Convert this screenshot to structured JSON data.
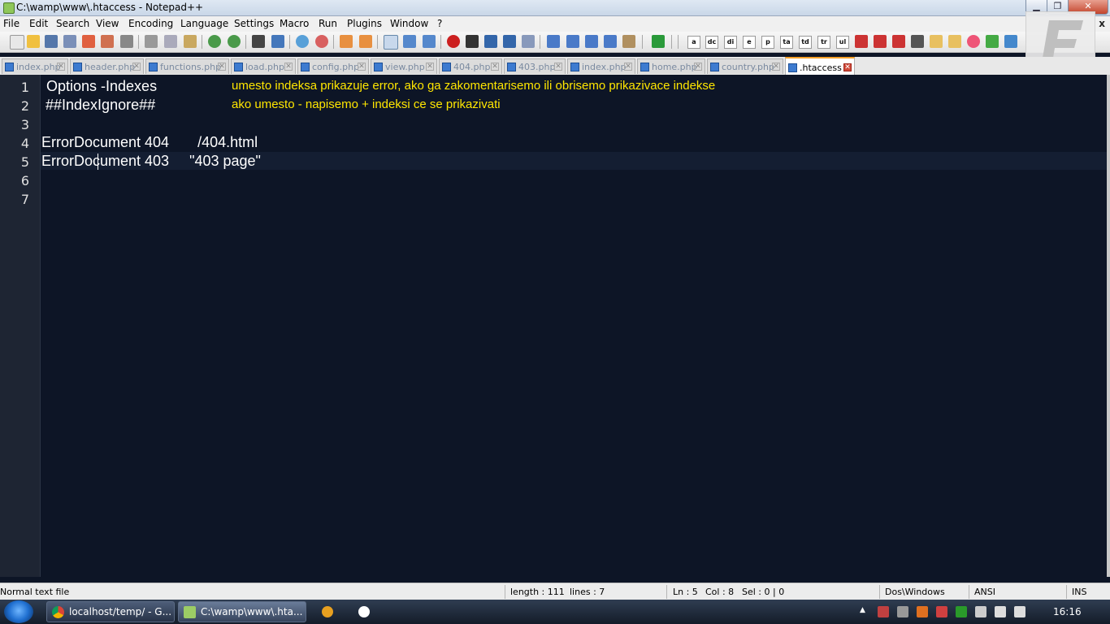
{
  "window": {
    "title": "C:\\wamp\\www\\.htaccess - Notepad++",
    "menu_close": "x"
  },
  "menu": [
    "File",
    "Edit",
    "Search",
    "View",
    "Encoding",
    "Language",
    "Settings",
    "Macro",
    "Run",
    "Plugins",
    "Window",
    "?"
  ],
  "toolbar": {
    "text_buttons": [
      "a",
      "dc",
      "di",
      "e",
      "p",
      "ta",
      "td",
      "tr",
      "ul"
    ]
  },
  "tabs": [
    {
      "label": "index.php",
      "active": false
    },
    {
      "label": "header.php",
      "active": false
    },
    {
      "label": "functions.php",
      "active": false
    },
    {
      "label": "load.php",
      "active": false
    },
    {
      "label": "config.php",
      "active": false
    },
    {
      "label": "view.php",
      "active": false
    },
    {
      "label": "404.php",
      "active": false
    },
    {
      "label": "403.php",
      "active": false
    },
    {
      "label": "index.php",
      "active": false
    },
    {
      "label": "home.php",
      "active": false
    },
    {
      "label": "country.php",
      "active": false
    },
    {
      "label": ".htaccess",
      "active": true
    }
  ],
  "editor": {
    "line_numbers": [
      "1",
      "2",
      "3",
      "4",
      "5",
      "6",
      "7"
    ],
    "lines": {
      "l1": "Options -Indexes",
      "l2": "##IndexIgnore##",
      "l4": "ErrorDocument 404       /404.html",
      "l5": "ErrorDocument 403     \"403 page\""
    },
    "comments": {
      "c1": "umesto indeksa prikazuje error, ako ga zakomentarisemo ili obrisemo prikazivace indekse",
      "c2": "ako umesto - napisemo + indeksi ce se prikazivati"
    },
    "colors": {
      "background": "#0d1526",
      "text": "#ffffff",
      "comment": "#ffe600"
    }
  },
  "status": {
    "file_type": "Normal text file",
    "length": "length : 111",
    "lines": "lines : 7",
    "ln": "Ln : 5",
    "col": "Col : 8",
    "sel": "Sel : 0 | 0",
    "eol": "Dos\\Windows",
    "encoding": "ANSI",
    "mode": "INS"
  },
  "taskbar": {
    "items": [
      {
        "label": "localhost/temp/ - G...",
        "icon": "chrome-icon"
      },
      {
        "label": "C:\\wamp\\www\\.hta...",
        "icon": "notepad-plus-plus-icon"
      }
    ],
    "clock": "16:16"
  }
}
